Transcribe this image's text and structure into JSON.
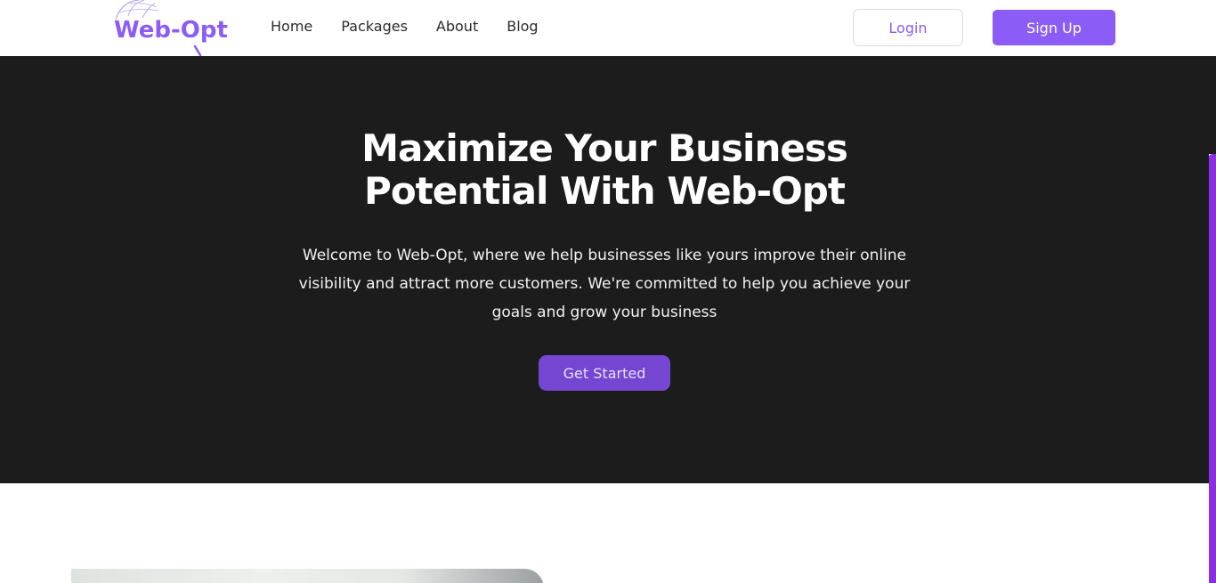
{
  "brand": {
    "logo_text": "Web-Opt",
    "accent_color": "#8b5cf6"
  },
  "nav": {
    "items": [
      {
        "label": "Home"
      },
      {
        "label": "Packages"
      },
      {
        "label": "About"
      },
      {
        "label": "Blog"
      }
    ],
    "login_label": "Login",
    "signup_label": "Sign Up"
  },
  "hero": {
    "title_line1": "Maximize Your Business",
    "title_line2": "Potential With Web-Opt",
    "text_line1": "Welcome to Web-Opt, where we help businesses like yours improve their online",
    "text_line2": "visibility and attract more customers. We're committed to help you achieve your",
    "text_line3": "goals and grow your business",
    "cta_label": "Get Started",
    "background_color": "#1c1c1c",
    "cta_color": "#7546d1"
  },
  "icons": {
    "logo_mark": "globe-magnifier-icon"
  }
}
